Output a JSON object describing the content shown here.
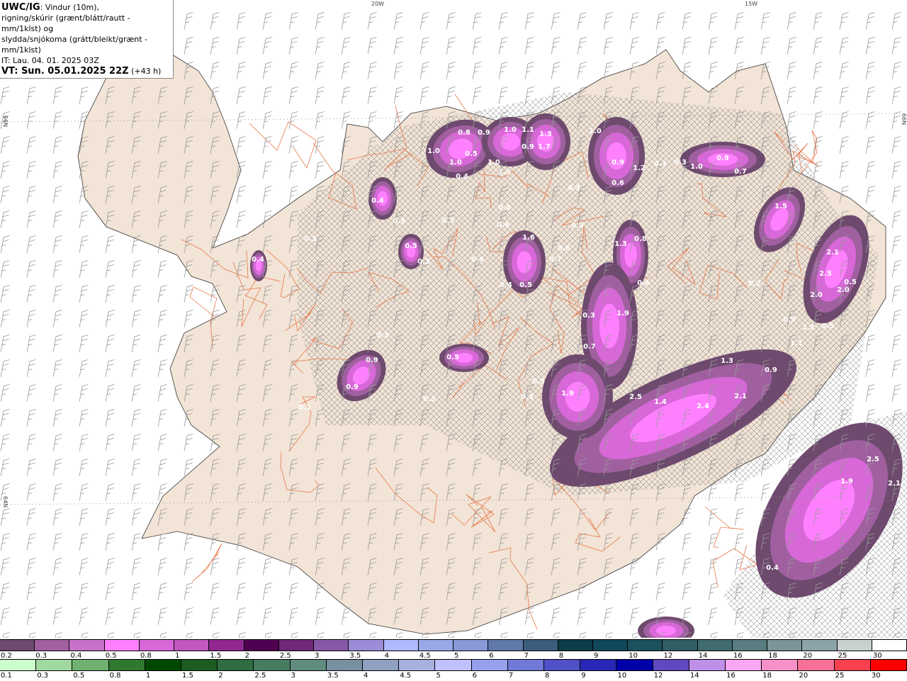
{
  "header": {
    "model": "UWC/IG",
    "line1": ": Vindur (10m),",
    "line2": "rigning/skúrir (grænt/blátt/rautt - mm/1klst) og",
    "line3": "slydda/snjókoma (grátt/bleikt/grænt - mm/1klst)",
    "issue_time": "IT: Lau. 04. 01. 2025 03Z",
    "valid_time": "VT: Sun. 05.01.2025 22Z",
    "lead": "(+43 h)"
  },
  "map": {
    "land_color": "#f2e4d6",
    "road_color": "#e8784a",
    "snow_color": "#d868d8",
    "lon_labels": [
      "20W",
      "15W"
    ],
    "lat_labels_left": [
      "66N",
      "64N"
    ],
    "lat_labels_right": [
      "66N"
    ],
    "precip_labels": [
      "0.8",
      "0.9",
      "1.0",
      "1.1",
      "1.3",
      "1.0",
      "1.0",
      "0.5",
      "1.0",
      "0.9",
      "1.7",
      "1.0",
      "0.9",
      "1.2",
      "0.3",
      "0.3",
      "1.0",
      "0.9",
      "0.7",
      "0.4",
      "0.6",
      "1.0",
      "0.3",
      "0.4",
      "1.5",
      "0.3",
      "0.3",
      "0.4",
      "0.3",
      "0.4",
      "1.6",
      "0.6",
      "1.3",
      "0.8",
      "2.1",
      "0.5",
      "0.3",
      "0.3",
      "0.7",
      "0.6",
      "0.5",
      "0.4",
      "2.5",
      "0.4",
      "0.5",
      "1.9",
      "2.0",
      "2.0",
      "0.4",
      "0.7",
      "0.9",
      "1.2",
      "0.5",
      "1.1",
      "0.3",
      "0.9",
      "0.5",
      "0.3",
      "0.9",
      "0.3",
      "1.3",
      "0.9",
      "1.9",
      "2.5",
      "1.4",
      "2.4",
      "2.1",
      "0.3",
      "0.2",
      "2.5",
      "1.9",
      "2.1",
      "0.4",
      "0.3",
      "0.2"
    ]
  },
  "legend": {
    "snow": {
      "labels": [
        "0.2",
        "0.3",
        "0.4",
        "0.5",
        "0.8",
        "1",
        "1.5",
        "2",
        "2.5",
        "3",
        "3.5",
        "4",
        "4.5",
        "5",
        "6",
        "7",
        "8",
        "9",
        "10",
        "12",
        "14",
        "16",
        "18",
        "20",
        "25",
        "30"
      ],
      "colors": [
        "#6e4a6e",
        "#a060a0",
        "#c870c8",
        "#ff80ff",
        "#d868d8",
        "#c058c0",
        "#902890",
        "#500050",
        "#702878",
        "#8858a8",
        "#9c8cd8",
        "#b0b8ff",
        "#98a8e8",
        "#8898d8",
        "#6078a8",
        "#3c5c7c",
        "#0c3c48",
        "#10485a",
        "#1c505c",
        "#305c64",
        "#406c70",
        "#587c80",
        "#7a9498",
        "#8ca4a8",
        "#c8d0d0",
        "#ffffff"
      ]
    },
    "rain": {
      "labels": [
        "0.1",
        "0.3",
        "0.5",
        "0.8",
        "1",
        "1.5",
        "2",
        "2.5",
        "3",
        "3.5",
        "4",
        "4.5",
        "5",
        "6",
        "7",
        "8",
        "9",
        "10",
        "12",
        "14",
        "16",
        "18",
        "20",
        "25",
        "30"
      ],
      "colors": [
        "#ccffcc",
        "#a0d8a0",
        "#70b070",
        "#307830",
        "#004800",
        "#1c5c20",
        "#306c40",
        "#487c60",
        "#608c80",
        "#7890a0",
        "#90a0c0",
        "#a8b0e0",
        "#c0c0ff",
        "#98a0ec",
        "#7078d8",
        "#5050c8",
        "#2828b8",
        "#0000a8",
        "#6048c0",
        "#c090e8",
        "#f8a8f0",
        "#f890c8",
        "#f87098",
        "#f84050",
        "#ff0000"
      ]
    }
  }
}
